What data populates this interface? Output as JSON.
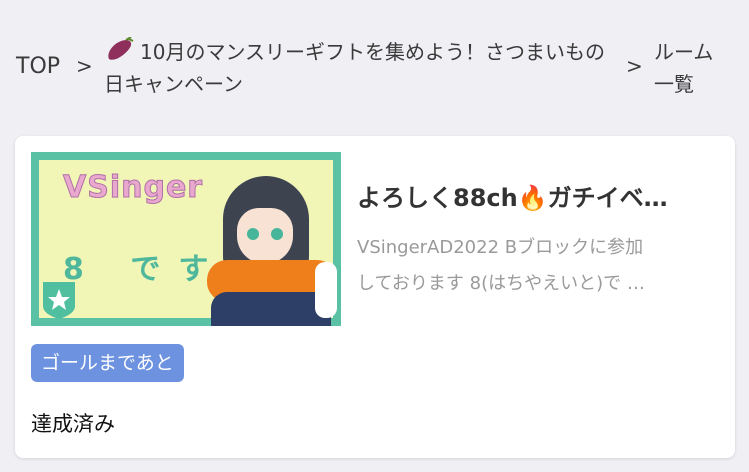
{
  "breadcrumb": {
    "top_label": "TOP",
    "separator": ">",
    "campaign_label": "10月のマンスリーギフトを集めよう！さつまいもの日キャンペーン",
    "campaign_icon": "sweet-potato-icon",
    "rooms_label": "ルーム一覧"
  },
  "room_card": {
    "title": "よろしく88ch🔥ガチイベ…",
    "description_lines": [
      "VSingerAD2022 Bブロックに参加",
      "しております 8(はちやえいと)で …"
    ],
    "thumbnail": {
      "logo_text": "VSinger",
      "caption": "8 です",
      "badge_icon": "star-icon"
    },
    "goal_badge": "ゴールまであと",
    "status": "達成済み"
  },
  "colors": {
    "background": "#efeff4",
    "card": "#ffffff",
    "goal_badge": "#6c92e0",
    "thumbnail_border": "#5bc1a4"
  }
}
